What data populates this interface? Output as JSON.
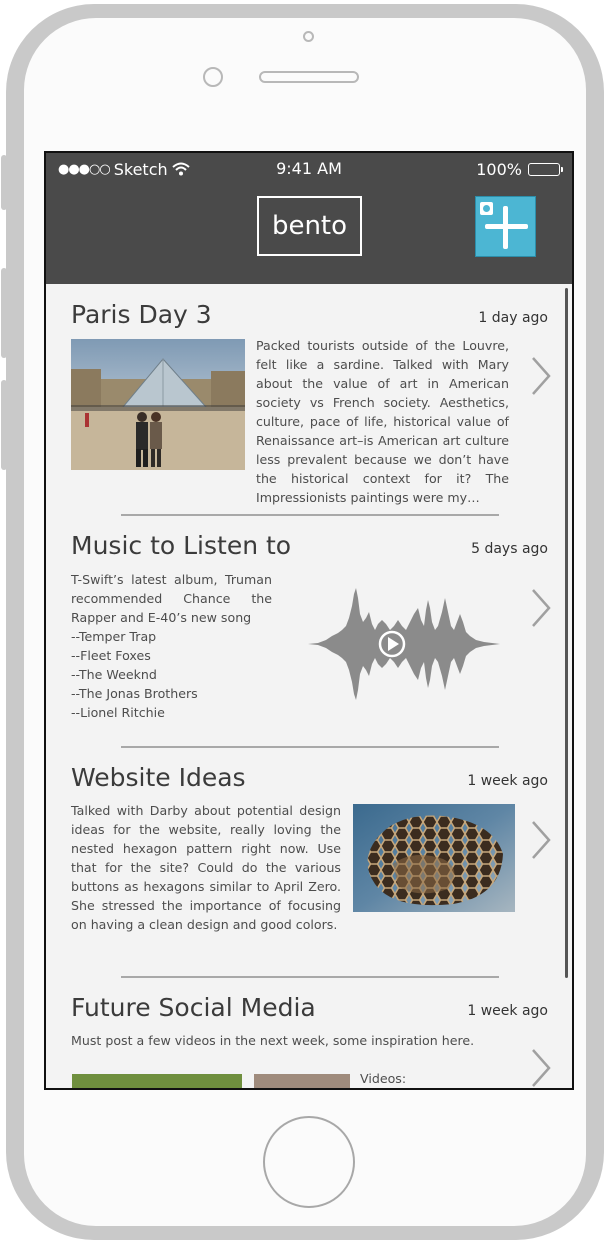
{
  "status_bar": {
    "carrier": "Sketch",
    "signal": "●●●○○",
    "time": "9:41 AM",
    "battery": "100%"
  },
  "header": {
    "logo": "bento",
    "add_button_icon": "plus-icon"
  },
  "entries": [
    {
      "title": "Paris Day 3",
      "time": "1 day ago",
      "body": "Packed tourists outside of the Louvre, felt like a sardine. Talked with Mary about the value of art in American society vs French society. Aesthetics, culture, pace of life, historical value of Renaissance art–is American art culture less prevalent because we don’t have the historical context for it? The Impressionists paintings were my…",
      "media": "photo"
    },
    {
      "title": "Music to  Listen to",
      "time": "5 days ago",
      "body_lines": [
        "T-Swift’s latest album, Truman recommended Chance the Rapper and E-40’s new song",
        "--Temper Trap",
        "--Fleet Foxes",
        "--The Weeknd",
        "--The Jonas Brothers",
        "--Lionel Ritchie"
      ],
      "media": "audio-waveform"
    },
    {
      "title": "Website Ideas",
      "time": "1 week ago",
      "body": "Talked with Darby about potential design ideas for the website, really loving the nested hexagon pattern right now. Use that for the site? Could do the various buttons as hexagons similar to April Zero. She stressed the importance of focusing on having a clean design and good colors.",
      "media": "photo"
    },
    {
      "title": "Future Social Media",
      "time": "1 week ago",
      "body": "Must post a few videos in the next week, some inspiration here.",
      "videos_label": "Videos:",
      "media": "photos"
    }
  ],
  "colors": {
    "header_bg": "#4a4a4a",
    "accent": "#4cb6d3",
    "content_bg": "#f3f3f3"
  }
}
